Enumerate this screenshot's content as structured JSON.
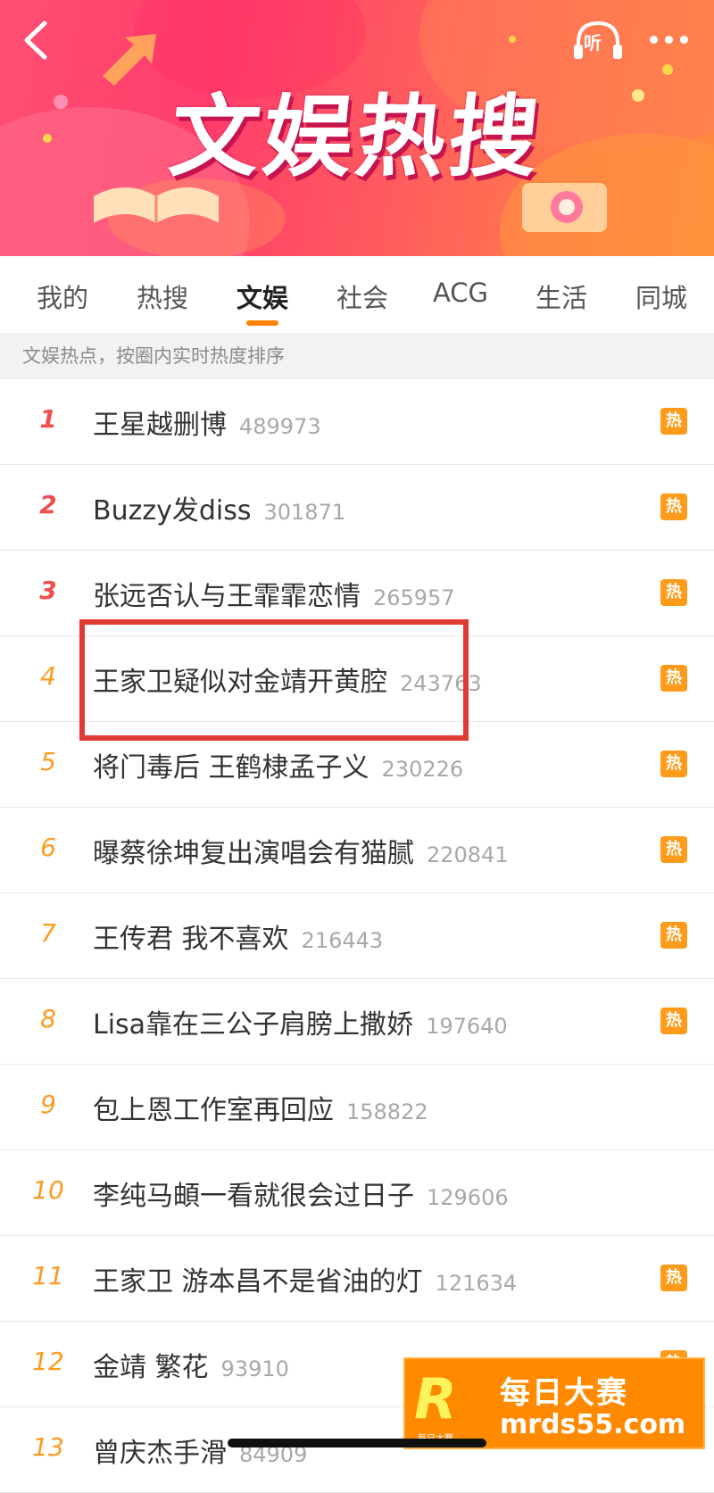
{
  "header": {
    "banner_title": "文娱热搜",
    "listen_label": "听"
  },
  "tabs": [
    {
      "label": "我的"
    },
    {
      "label": "热搜"
    },
    {
      "label": "文娱",
      "active": true
    },
    {
      "label": "社会"
    },
    {
      "label": "ACG"
    },
    {
      "label": "生活"
    },
    {
      "label": "同城"
    }
  ],
  "subtitle": "文娱热点，按圈内实时热度排序",
  "hot_badge_label": "热",
  "items": [
    {
      "rank": "1",
      "title": "王星越删博",
      "count": "489973",
      "hot": true
    },
    {
      "rank": "2",
      "title": "Buzzy发diss",
      "count": "301871",
      "hot": true
    },
    {
      "rank": "3",
      "title": "张远否认与王霏霏恋情",
      "count": "265957",
      "hot": true
    },
    {
      "rank": "4",
      "title": "王家卫疑似对金靖开黄腔",
      "count": "243763",
      "hot": true
    },
    {
      "rank": "5",
      "title": "将门毒后 王鹤棣孟子义",
      "count": "230226",
      "hot": true
    },
    {
      "rank": "6",
      "title": "曝蔡徐坤复出演唱会有猫腻",
      "count": "220841",
      "hot": true
    },
    {
      "rank": "7",
      "title": "王传君 我不喜欢",
      "count": "216443",
      "hot": true
    },
    {
      "rank": "8",
      "title": "Lisa靠在三公子肩膀上撒娇",
      "count": "197640",
      "hot": true
    },
    {
      "rank": "9",
      "title": "包上恩工作室再回应",
      "count": "158822",
      "hot": false
    },
    {
      "rank": "10",
      "title": "李纯马頔一看就很会过日子",
      "count": "129606",
      "hot": false
    },
    {
      "rank": "11",
      "title": "王家卫 游本昌不是省油的灯",
      "count": "121634",
      "hot": true
    },
    {
      "rank": "12",
      "title": "金靖 繁花",
      "count": "93910",
      "hot": true
    },
    {
      "rank": "13",
      "title": "曾庆杰手滑",
      "count": "84909",
      "hot": false
    }
  ],
  "watermark": {
    "logo": "R",
    "line1": "每日大赛",
    "line2": "mrds55.com",
    "small": "每日大赛"
  },
  "colors": {
    "accent": "#ff8200",
    "hot_badge": "#ff9b1a",
    "top_rank": "#f05050",
    "rank": "#ff9a1f",
    "highlight": "#e13a33"
  }
}
